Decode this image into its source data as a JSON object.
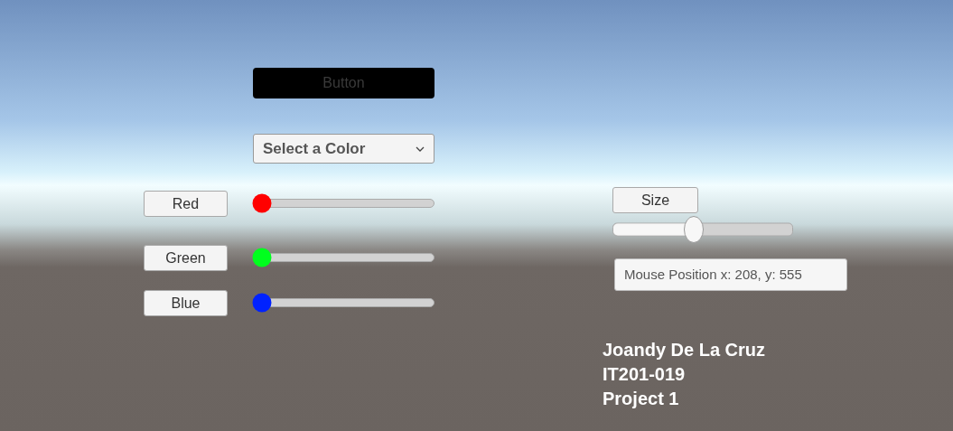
{
  "button": {
    "label": "Button"
  },
  "dropdown": {
    "label": "Select a Color"
  },
  "color_controls": [
    {
      "label": "Red",
      "color": "#ff0000",
      "level": 0
    },
    {
      "label": "Green",
      "color": "#00ff1e",
      "level": 0
    },
    {
      "label": "Blue",
      "color": "#0022ff",
      "level": 0
    }
  ],
  "size": {
    "label": "Size",
    "level": 0.45
  },
  "mouse_position": "Mouse Position x: 208, y: 555",
  "credits": [
    "Joandy De La Cruz",
    "IT201-019",
    "Project 1"
  ]
}
